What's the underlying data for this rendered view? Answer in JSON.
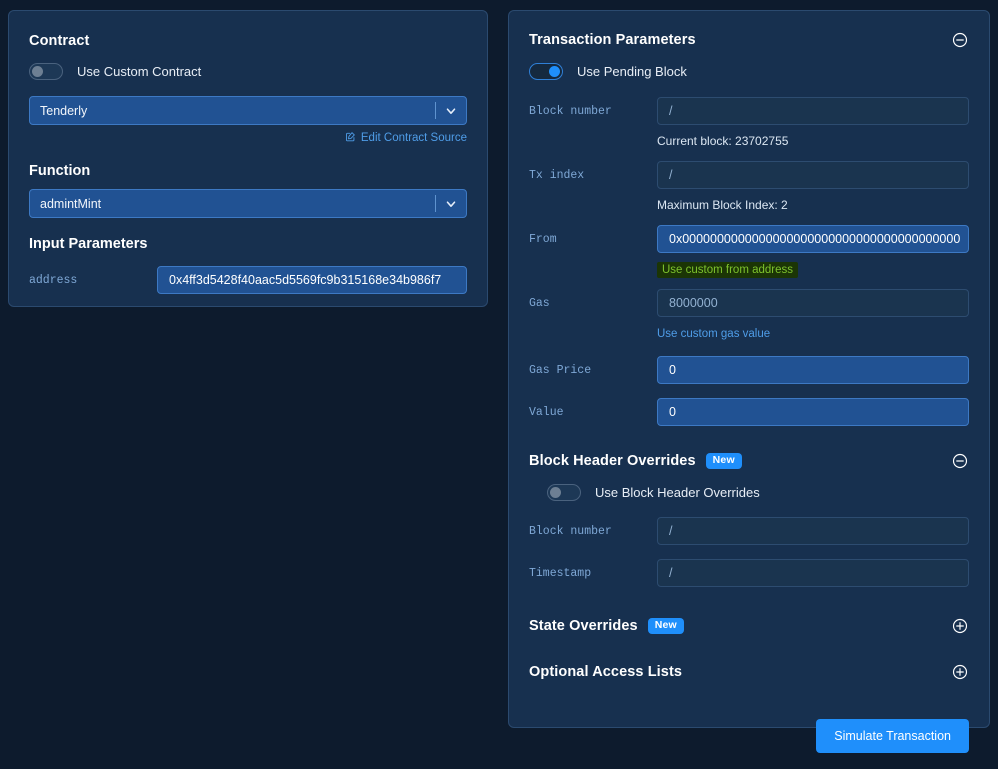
{
  "contract": {
    "title": "Contract",
    "custom_contract_toggle_label": "Use Custom Contract",
    "custom_contract_toggle_state": "off",
    "contract_select_value": "Tenderly",
    "edit_contract_link": "Edit Contract Source",
    "function_label": "Function",
    "function_select_value": "admintMint",
    "input_parameters_label": "Input Parameters",
    "parameters": [
      {
        "name": "address",
        "value": "0x4ff3d5428f40aac5d5569fc9b315168e34b986f7"
      }
    ]
  },
  "transaction": {
    "title": "Transaction Parameters",
    "pending_block_toggle_label": "Use Pending Block",
    "pending_block_toggle_state": "on",
    "fields": [
      {
        "label": "Block number",
        "value": "/",
        "state": "empty"
      },
      {
        "label": "Tx index",
        "value": "/",
        "state": "empty"
      },
      {
        "label": "From",
        "value": "0x0000000000000000000000000000000000000000",
        "state": "filled"
      },
      {
        "label": "Gas",
        "value": "8000000",
        "state": "empty"
      },
      {
        "label": "Gas Price",
        "value": "0",
        "state": "filled"
      },
      {
        "label": "Value",
        "value": "0",
        "state": "filled"
      }
    ],
    "current_block_note": "Current block: 23702755",
    "max_block_index_note": "Maximum Block Index: 2",
    "custom_from_address_link": "Use custom from address",
    "custom_gas_value_link": "Use custom gas value"
  },
  "block_header_overrides": {
    "title": "Block Header Overrides",
    "badge": "New",
    "toggle_label": "Use Block Header Overrides",
    "toggle_state": "off",
    "fields": [
      {
        "label": "Block number",
        "value": "/",
        "state": "empty"
      },
      {
        "label": "Timestamp",
        "value": "/",
        "state": "empty"
      }
    ]
  },
  "state_overrides": {
    "title": "State Overrides",
    "badge": "New"
  },
  "access_lists": {
    "title": "Optional Access Lists"
  },
  "actions": {
    "simulate_button": "Simulate Transaction"
  },
  "colors": {
    "page_bg": "#0d1b2d",
    "panel_bg": "#17304f",
    "accent_blue": "#1f8ffb",
    "input_filled": "#215293",
    "label_blue": "#7fa8d6",
    "link_blue": "#4f9de8",
    "highlight_bg": "#1b3505",
    "highlight_text": "#7dc32d"
  }
}
